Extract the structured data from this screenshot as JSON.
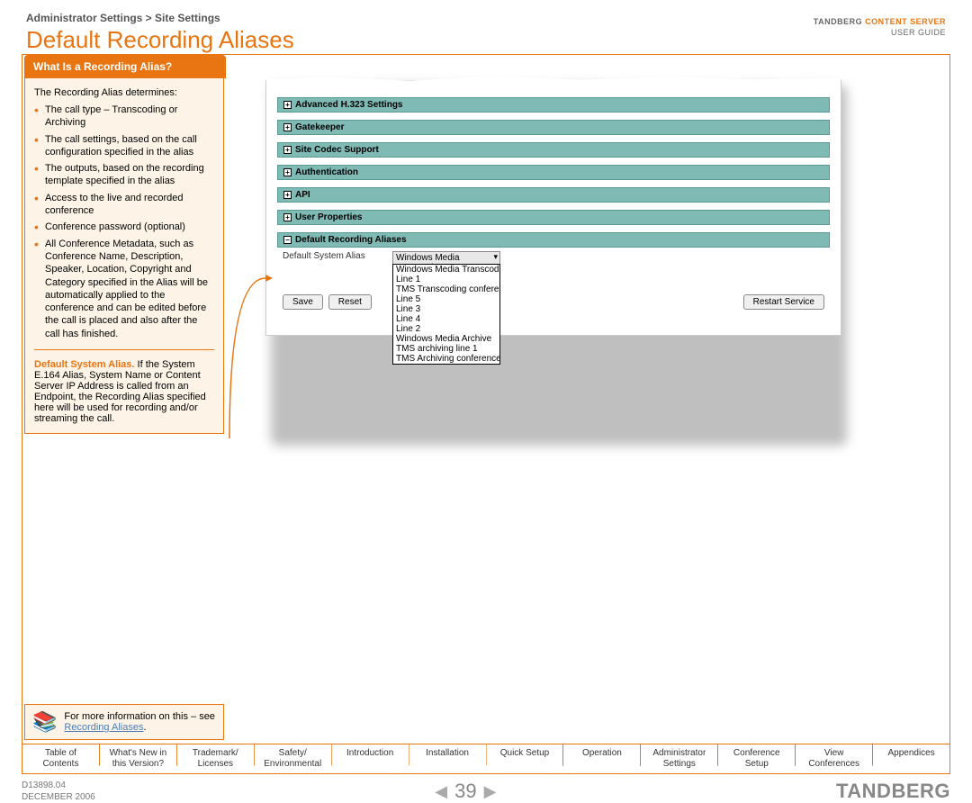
{
  "header": {
    "breadcrumb": "Administrator Settings > Site Settings",
    "title": "Default Recording Aliases",
    "brand_name": "TANDBERG",
    "brand_product": "CONTENT SERVER",
    "brand_sub": "USER GUIDE"
  },
  "sidebar": {
    "tab_title": "What Is a Recording Alias?",
    "intro": "The Recording Alias determines:",
    "bullets": [
      "The call type – Transcoding or Archiving",
      "The call settings, based on the call configuration specified in the alias",
      "The outputs, based on the recording template specified in the alias",
      "Access to the live and recorded conference",
      "Conference password (optional)",
      "All Conference Metadata, such as Conference Name, Description, Speaker, Location, Copyright and Category specified in the Alias will be automatically applied to the conference and can be edited before the call is placed and also after the call has finished."
    ],
    "default_label": "Default System Alias.",
    "default_text": " If the System E.164 Alias, System Name or Content Server IP Address is called from an Endpoint, the Recording Alias specified here will be used for recording and/or streaming the call.",
    "more_info_pre": "For more information on this – see ",
    "more_info_link": "Recording Aliases",
    "more_info_post": "."
  },
  "screenshot": {
    "sections": [
      "Advanced H.323 Settings",
      "Gatekeeper",
      "Site Codec Support",
      "Authentication",
      "API",
      "User Properties",
      "Default Recording Aliases"
    ],
    "field_label": "Default System Alias",
    "selected": "Windows Media Transcode",
    "options": [
      "Windows Media Transcode",
      "Line 1",
      "TMS Transcoding conference",
      "Line 5",
      "Line 3",
      "Line 4",
      "Line 2",
      "Windows Media Archive",
      "TMS archiving line 1",
      "TMS Archiving conference"
    ],
    "save": "Save",
    "reset": "Reset",
    "restart": "Restart Service"
  },
  "nav": [
    "Table of\nContents",
    "What's New in\nthis Version?",
    "Trademark/\nLicenses",
    "Safety/\nEnvironmental",
    "Introduction",
    "Installation",
    "Quick Setup",
    "Operation",
    "Administrator\nSettings",
    "Conference\nSetup",
    "View\nConferences",
    "Appendices"
  ],
  "footer": {
    "doc_id": "D13898.04",
    "date": "DECEMBER 2006",
    "page": "39",
    "logo": "TANDBERG"
  }
}
